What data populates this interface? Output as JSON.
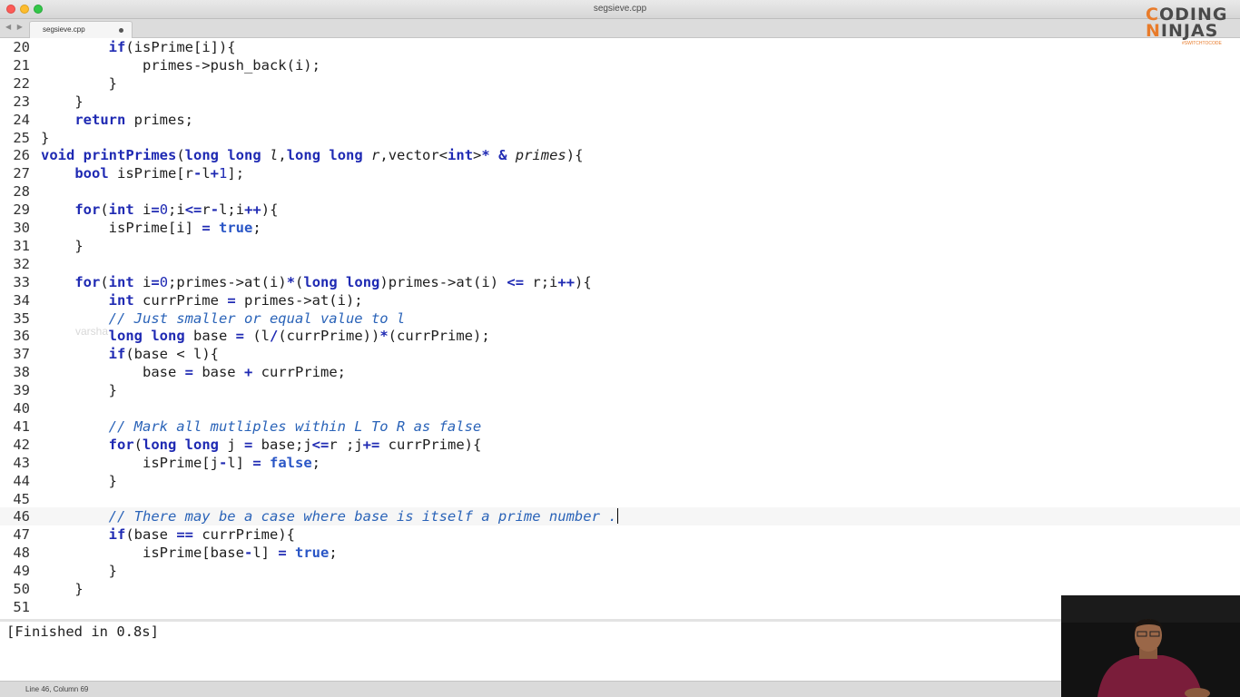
{
  "window": {
    "title": "segsieve.cpp"
  },
  "tabs": [
    {
      "label": "segsieve.cpp",
      "dirty": true
    }
  ],
  "editor": {
    "first_line": 20,
    "active_line": 46,
    "lines": [
      "        if(isPrime[i]){",
      "            primes->push_back(i);",
      "        }",
      "    }",
      "    return primes;",
      "}",
      "void printPrimes(long long l,long long r,vector<int>* & primes){",
      "    bool isPrime[r-l+1];",
      "",
      "    for(int i=0;i<=r-l;i++){",
      "        isPrime[i] = true;",
      "    }",
      "",
      "    for(int i=0;primes->at(i)*(long long)primes->at(i) <= r;i++){",
      "        int currPrime = primes->at(i);",
      "        // Just smaller or equal value to l",
      "        long long base = (l/(currPrime))*(currPrime);",
      "        if(base < l){",
      "            base = base + currPrime;",
      "        }",
      "",
      "        // Mark all mutliples within L To R as false",
      "        for(long long j = base;j<=r ;j+= currPrime){",
      "            isPrime[j-l] = false;",
      "        }",
      "",
      "        // There may be a case where base is itself a prime number .",
      "        if(base == currPrime){",
      "            isPrime[base-l] = true;",
      "        }",
      "    }",
      ""
    ],
    "ghost_text": "varsha"
  },
  "output": {
    "text": "[Finished in 0.8s]"
  },
  "status": {
    "text": "Line 46, Column 69"
  },
  "logo": {
    "line1": "CODING",
    "line2": "NINJAS",
    "hashtag": "#SWITCHTOCODE",
    "accent": "#e87b2a"
  },
  "colors": {
    "keyword": "#1f2ab3",
    "comment": "#2a63b8",
    "text": "#1e1e1e"
  }
}
